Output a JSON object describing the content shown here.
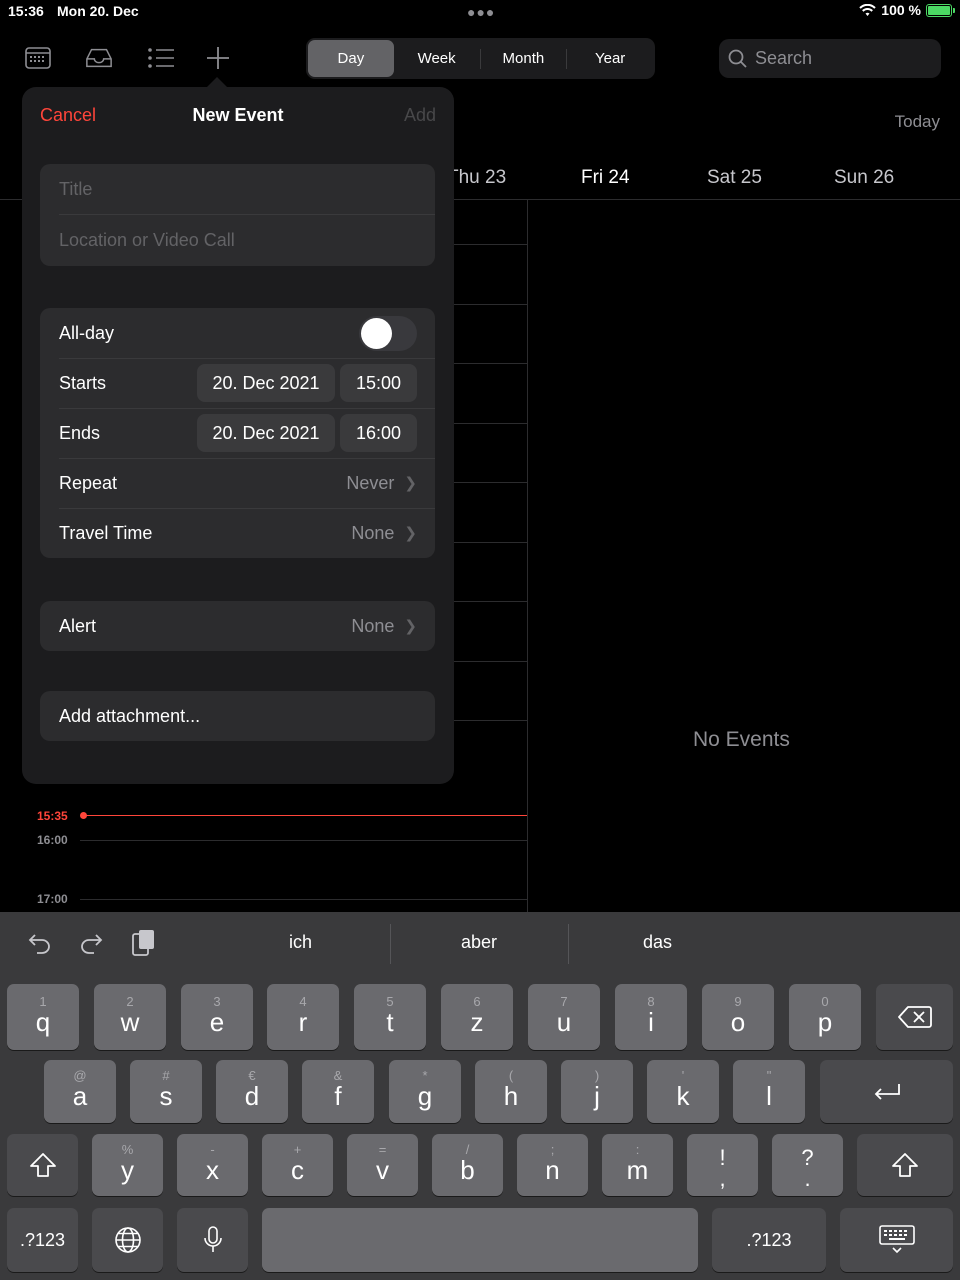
{
  "status": {
    "time": "15:36",
    "date": "Mon 20. Dec",
    "battery": "100 %",
    "battery_level": 1.0
  },
  "toolbar": {
    "icons": [
      "calendars-icon",
      "inbox-icon",
      "list-icon",
      "plus-icon"
    ],
    "views": [
      {
        "label": "Day",
        "active": true
      },
      {
        "label": "Week",
        "active": false
      },
      {
        "label": "Month",
        "active": false
      },
      {
        "label": "Year",
        "active": false
      }
    ],
    "search_placeholder": "Search"
  },
  "calendar": {
    "today_button": "Today",
    "days": [
      "Thu 23",
      "Fri 24",
      "Sat 25",
      "Sun 26"
    ],
    "selected_day": "Fri 24",
    "no_events": "No Events",
    "current_time": "15:35",
    "hours": [
      "16:00",
      "17:00"
    ]
  },
  "new_event": {
    "cancel": "Cancel",
    "title": "New Event",
    "add": "Add",
    "title_placeholder": "Title",
    "location_placeholder": "Location or Video Call",
    "all_day_label": "All-day",
    "all_day": false,
    "starts_label": "Starts",
    "starts_date": "20. Dec 2021",
    "starts_time": "15:00",
    "ends_label": "Ends",
    "ends_date": "20. Dec 2021",
    "ends_time": "16:00",
    "repeat_label": "Repeat",
    "repeat_value": "Never",
    "travel_label": "Travel Time",
    "travel_value": "None",
    "alert_label": "Alert",
    "alert_value": "None",
    "attachment_label": "Add attachment..."
  },
  "keyboard": {
    "suggestions": [
      "ich",
      "aber",
      "das"
    ],
    "row1": [
      [
        "1",
        "q"
      ],
      [
        "2",
        "w"
      ],
      [
        "3",
        "e"
      ],
      [
        "4",
        "r"
      ],
      [
        "5",
        "t"
      ],
      [
        "6",
        "z"
      ],
      [
        "7",
        "u"
      ],
      [
        "8",
        "i"
      ],
      [
        "9",
        "o"
      ],
      [
        "0",
        "p"
      ]
    ],
    "row2": [
      [
        "@",
        "a"
      ],
      [
        "#",
        "s"
      ],
      [
        "€",
        "d"
      ],
      [
        "&",
        "f"
      ],
      [
        "*",
        "g"
      ],
      [
        "(",
        "h"
      ],
      [
        ")",
        "j"
      ],
      [
        "'",
        "k"
      ],
      [
        "\"",
        "l"
      ]
    ],
    "row3": [
      [
        "%",
        "y"
      ],
      [
        "-",
        "x"
      ],
      [
        "+",
        "c"
      ],
      [
        "=",
        "v"
      ],
      [
        "/",
        "b"
      ],
      [
        ";",
        "n"
      ],
      [
        ":",
        "m"
      ],
      [
        "!",
        ","
      ],
      [
        "?",
        "."
      ]
    ],
    "numbers_label": ".?123"
  },
  "colors": {
    "accent_red": "#ff453a",
    "battery_green": "#4cd964"
  }
}
